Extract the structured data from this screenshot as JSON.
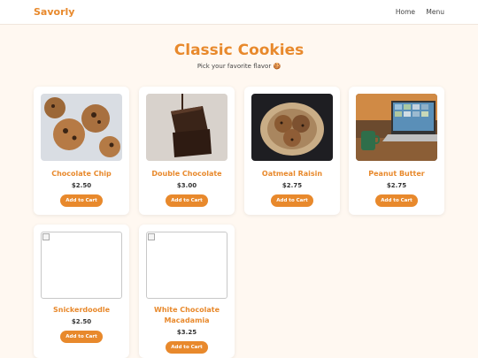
{
  "nav": {
    "brand": "Savorly",
    "links": [
      "Home",
      "Menu"
    ]
  },
  "header": {
    "title": "Classic Cookies",
    "subtitle": "Pick your favorite flavor 🍪"
  },
  "products": [
    {
      "name": "Chocolate Chip",
      "price": "$2.50",
      "button": "Add to Cart"
    },
    {
      "name": "Double Chocolate",
      "price": "$3.00",
      "button": "Add to Cart"
    },
    {
      "name": "Oatmeal Raisin",
      "price": "$2.75",
      "button": "Add to Cart"
    },
    {
      "name": "Peanut Butter",
      "price": "$2.75",
      "button": "Add to Cart"
    },
    {
      "name": "Snickerdoodle",
      "price": "$2.50",
      "button": "Add to Cart"
    },
    {
      "name": "White Chocolate Macadamia",
      "price": "$3.25",
      "button": "Add to Cart"
    }
  ],
  "colors": {
    "accent": "#e8892c",
    "background": "#fff8f1"
  }
}
